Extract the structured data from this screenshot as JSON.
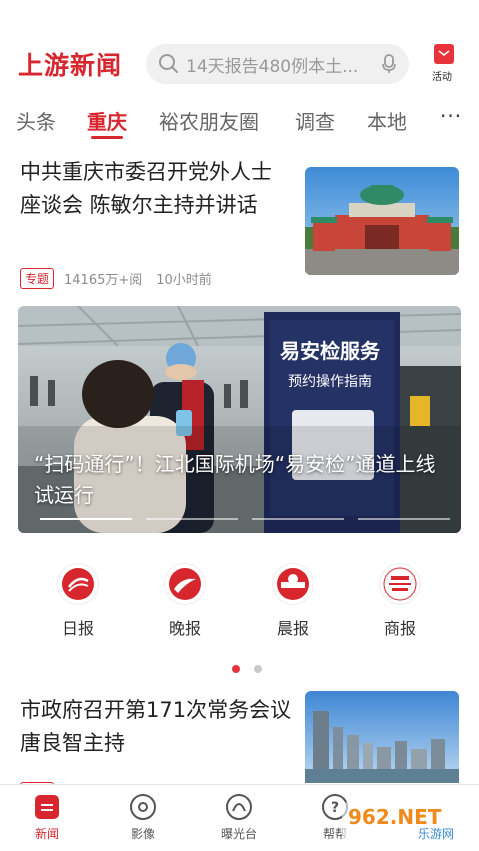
{
  "header": {
    "logo_text": "上游新闻",
    "search_placeholder": "14天报告480例本土...",
    "activity_label": "活动"
  },
  "tabs": [
    {
      "label": "头条",
      "active": false
    },
    {
      "label": "重庆",
      "active": true
    },
    {
      "label": "裕农朋友圈",
      "active": false
    },
    {
      "label": "调查",
      "active": false
    },
    {
      "label": "本地",
      "active": false
    }
  ],
  "more_label": "···",
  "article1": {
    "title": "中共重庆市委召开党外人士座谈会 陈敏尔主持并讲话",
    "badge": "专题",
    "views": "14165万+阅",
    "time": "10小时前"
  },
  "banner": {
    "caption": "“扫码通行”！江北国际机场“易安检”通道上线试运行",
    "sign_title": "易安检服务",
    "sign_subtitle": "预约操作指南",
    "slides": 4,
    "active_slide": 0
  },
  "quick_links": [
    {
      "label": "日报",
      "icon": "daily-icon"
    },
    {
      "label": "晚报",
      "icon": "evening-icon"
    },
    {
      "label": "晨报",
      "icon": "morning-icon"
    },
    {
      "label": "商报",
      "icon": "business-icon"
    }
  ],
  "quick_pages": {
    "count": 2,
    "active": 0
  },
  "article2": {
    "title": "市政府召开第171次常务会议 唐良智主持"
  },
  "bottom_nav": [
    {
      "label": "新闻",
      "icon": "news-icon",
      "active": true
    },
    {
      "label": "影像",
      "icon": "video-icon",
      "active": false
    },
    {
      "label": "曝光台",
      "icon": "exposure-icon",
      "active": false
    },
    {
      "label": "帮帮",
      "icon": "help-icon",
      "active": false
    }
  ],
  "watermark": {
    "text": "962.NET",
    "subtext": "乐游网"
  },
  "colors": {
    "accent": "#d8262f",
    "search_bg": "#f0f0f0",
    "text_meta": "#8c8c8c"
  }
}
